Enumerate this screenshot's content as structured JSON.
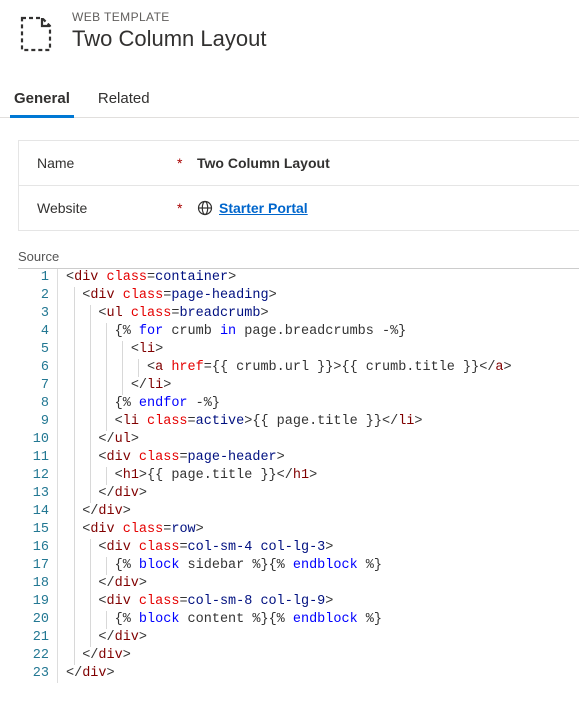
{
  "header": {
    "eyebrow": "WEB TEMPLATE",
    "title": "Two Column Layout"
  },
  "tabs": {
    "general": "General",
    "related": "Related"
  },
  "fields": {
    "name_label": "Name",
    "name_required": "*",
    "name_value": "Two Column Layout",
    "website_label": "Website",
    "website_required": "*",
    "website_value": "Starter Portal"
  },
  "source": {
    "label": "Source",
    "lines": [
      {
        "indent": 0,
        "tokens": [
          [
            "punc",
            "<"
          ],
          [
            "tag",
            "div "
          ],
          [
            "attr",
            "class"
          ],
          [
            "punc",
            "="
          ],
          [
            "var",
            "container"
          ],
          [
            "punc",
            ">"
          ]
        ]
      },
      {
        "indent": 1,
        "tokens": [
          [
            "punc",
            "<"
          ],
          [
            "tag",
            "div "
          ],
          [
            "attr",
            "class"
          ],
          [
            "punc",
            "="
          ],
          [
            "var",
            "page-heading"
          ],
          [
            "punc",
            ">"
          ]
        ]
      },
      {
        "indent": 2,
        "tokens": [
          [
            "punc",
            "<"
          ],
          [
            "tag",
            "ul "
          ],
          [
            "attr",
            "class"
          ],
          [
            "punc",
            "="
          ],
          [
            "var",
            "breadcrumb"
          ],
          [
            "punc",
            ">"
          ]
        ]
      },
      {
        "indent": 3,
        "tokens": [
          [
            "delim",
            "{% "
          ],
          [
            "kw",
            "for"
          ],
          [
            "txt",
            " crumb "
          ],
          [
            "kw",
            "in"
          ],
          [
            "txt",
            " page.breadcrumbs "
          ],
          [
            "delim",
            "-%}"
          ]
        ]
      },
      {
        "indent": 4,
        "tokens": [
          [
            "punc",
            "<"
          ],
          [
            "tag",
            "li"
          ],
          [
            "punc",
            ">"
          ]
        ]
      },
      {
        "indent": 5,
        "tokens": [
          [
            "punc",
            "<"
          ],
          [
            "tag",
            "a "
          ],
          [
            "attr",
            "href"
          ],
          [
            "punc",
            "="
          ],
          [
            "delim",
            "{{"
          ],
          [
            "txt",
            " crumb.url "
          ],
          [
            "delim",
            "}}"
          ],
          [
            "punc",
            ">"
          ],
          [
            "delim",
            "{{"
          ],
          [
            "txt",
            " crumb.title "
          ],
          [
            "delim",
            "}}"
          ],
          [
            "punc",
            "</"
          ],
          [
            "tag",
            "a"
          ],
          [
            "punc",
            ">"
          ]
        ]
      },
      {
        "indent": 4,
        "tokens": [
          [
            "punc",
            "</"
          ],
          [
            "tag",
            "li"
          ],
          [
            "punc",
            ">"
          ]
        ]
      },
      {
        "indent": 3,
        "tokens": [
          [
            "delim",
            "{% "
          ],
          [
            "kw",
            "endfor"
          ],
          [
            "delim",
            " -%}"
          ]
        ]
      },
      {
        "indent": 3,
        "tokens": [
          [
            "punc",
            "<"
          ],
          [
            "tag",
            "li "
          ],
          [
            "attr",
            "class"
          ],
          [
            "punc",
            "="
          ],
          [
            "var",
            "active"
          ],
          [
            "punc",
            ">"
          ],
          [
            "delim",
            "{{"
          ],
          [
            "txt",
            " page.title "
          ],
          [
            "delim",
            "}}"
          ],
          [
            "punc",
            "</"
          ],
          [
            "tag",
            "li"
          ],
          [
            "punc",
            ">"
          ]
        ]
      },
      {
        "indent": 2,
        "tokens": [
          [
            "punc",
            "</"
          ],
          [
            "tag",
            "ul"
          ],
          [
            "punc",
            ">"
          ]
        ]
      },
      {
        "indent": 2,
        "tokens": [
          [
            "punc",
            "<"
          ],
          [
            "tag",
            "div "
          ],
          [
            "attr",
            "class"
          ],
          [
            "punc",
            "="
          ],
          [
            "var",
            "page-header"
          ],
          [
            "punc",
            ">"
          ]
        ]
      },
      {
        "indent": 3,
        "tokens": [
          [
            "punc",
            "<"
          ],
          [
            "tag",
            "h1"
          ],
          [
            "punc",
            ">"
          ],
          [
            "delim",
            "{{"
          ],
          [
            "txt",
            " page.title "
          ],
          [
            "delim",
            "}}"
          ],
          [
            "punc",
            "</"
          ],
          [
            "tag",
            "h1"
          ],
          [
            "punc",
            ">"
          ]
        ]
      },
      {
        "indent": 2,
        "tokens": [
          [
            "punc",
            "</"
          ],
          [
            "tag",
            "div"
          ],
          [
            "punc",
            ">"
          ]
        ]
      },
      {
        "indent": 1,
        "tokens": [
          [
            "punc",
            "</"
          ],
          [
            "tag",
            "div"
          ],
          [
            "punc",
            ">"
          ]
        ]
      },
      {
        "indent": 1,
        "tokens": [
          [
            "punc",
            "<"
          ],
          [
            "tag",
            "div "
          ],
          [
            "attr",
            "class"
          ],
          [
            "punc",
            "="
          ],
          [
            "var",
            "row"
          ],
          [
            "punc",
            ">"
          ]
        ]
      },
      {
        "indent": 2,
        "tokens": [
          [
            "punc",
            "<"
          ],
          [
            "tag",
            "div "
          ],
          [
            "attr",
            "class"
          ],
          [
            "punc",
            "="
          ],
          [
            "var",
            "col-sm-4 col-lg-3"
          ],
          [
            "punc",
            ">"
          ]
        ]
      },
      {
        "indent": 3,
        "tokens": [
          [
            "delim",
            "{% "
          ],
          [
            "kw",
            "block"
          ],
          [
            "txt",
            " sidebar "
          ],
          [
            "delim",
            "%}"
          ],
          [
            "delim",
            "{% "
          ],
          [
            "kw",
            "endblock"
          ],
          [
            "delim",
            " %}"
          ]
        ]
      },
      {
        "indent": 2,
        "tokens": [
          [
            "punc",
            "</"
          ],
          [
            "tag",
            "div"
          ],
          [
            "punc",
            ">"
          ]
        ]
      },
      {
        "indent": 2,
        "tokens": [
          [
            "punc",
            "<"
          ],
          [
            "tag",
            "div "
          ],
          [
            "attr",
            "class"
          ],
          [
            "punc",
            "="
          ],
          [
            "var",
            "col-sm-8 col-lg-9"
          ],
          [
            "punc",
            ">"
          ]
        ]
      },
      {
        "indent": 3,
        "tokens": [
          [
            "delim",
            "{% "
          ],
          [
            "kw",
            "block"
          ],
          [
            "txt",
            " content "
          ],
          [
            "delim",
            "%}"
          ],
          [
            "delim",
            "{% "
          ],
          [
            "kw",
            "endblock"
          ],
          [
            "delim",
            " %}"
          ]
        ]
      },
      {
        "indent": 2,
        "tokens": [
          [
            "punc",
            "</"
          ],
          [
            "tag",
            "div"
          ],
          [
            "punc",
            ">"
          ]
        ]
      },
      {
        "indent": 1,
        "tokens": [
          [
            "punc",
            "</"
          ],
          [
            "tag",
            "div"
          ],
          [
            "punc",
            ">"
          ]
        ]
      },
      {
        "indent": 0,
        "tokens": [
          [
            "punc",
            "</"
          ],
          [
            "tag",
            "div"
          ],
          [
            "punc",
            ">"
          ]
        ]
      }
    ]
  }
}
